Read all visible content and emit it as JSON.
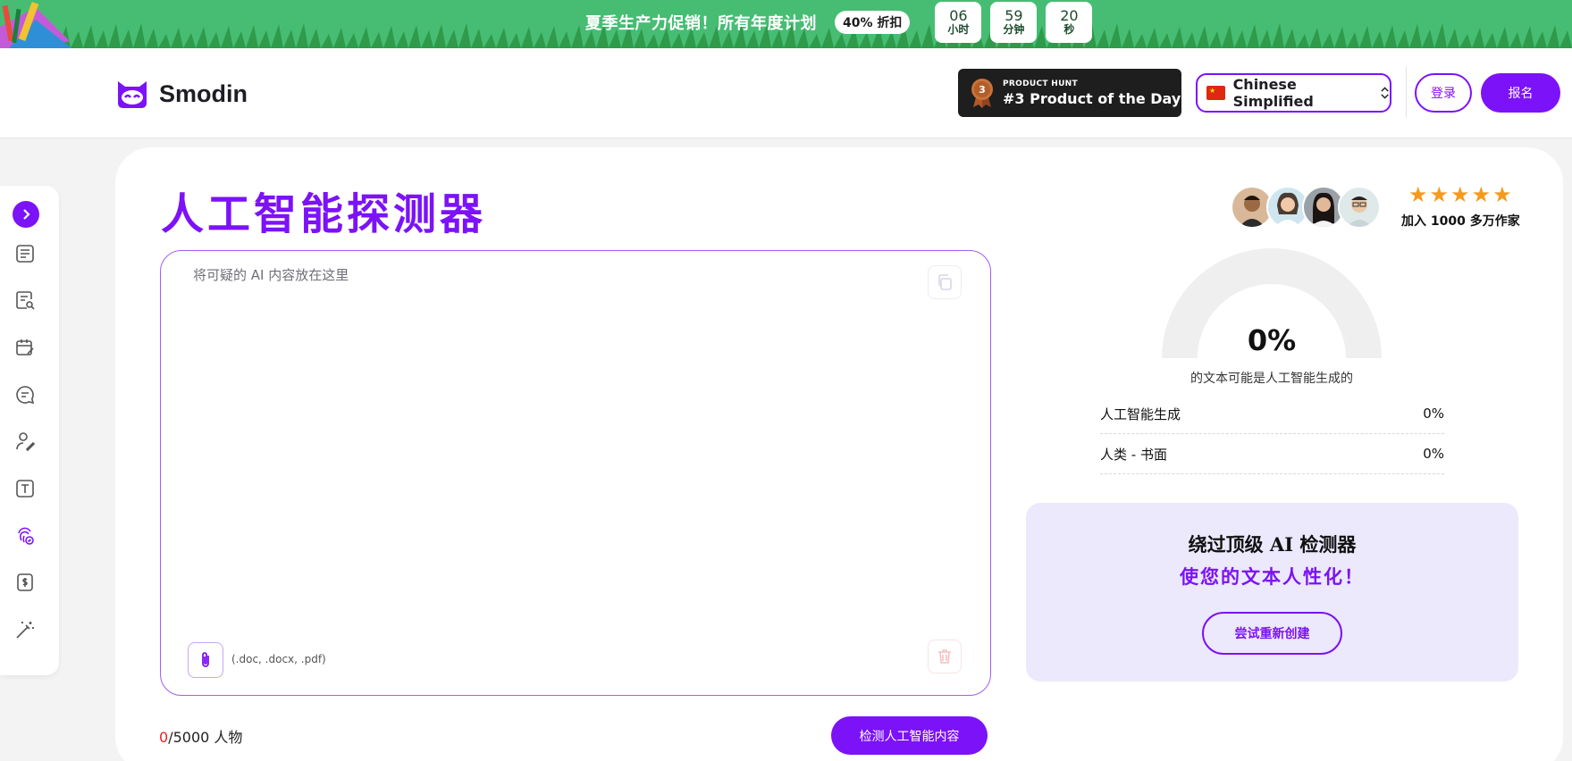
{
  "banner": {
    "text": "夏季生产力促销！所有年度计划",
    "discount": "40% 折扣",
    "timer": [
      {
        "value": "06",
        "unit": "小时"
      },
      {
        "value": "59",
        "unit": "分钟"
      },
      {
        "value": "20",
        "unit": "秒"
      }
    ]
  },
  "header": {
    "logo": "Smodin",
    "product_hunt": {
      "rank_digit": "3",
      "small": "PRODUCT HUNT",
      "big": "#3 Product of the Day"
    },
    "language": "Chinese Simplified",
    "login": "登录",
    "signup": "报名"
  },
  "sidebar": {
    "icons": [
      "document-lines-icon",
      "document-search-icon",
      "calendar-edit-icon",
      "chat-lines-icon",
      "user-pen-icon",
      "text-box-icon",
      "fingerprint-check-icon",
      "dollar-document-icon",
      "magic-wand-icon"
    ]
  },
  "main": {
    "title": "人工智能探测器",
    "placeholder": "将可疑的 AI 内容放在这里",
    "formats": "(.doc, .docx, .pdf)",
    "count_current": "0",
    "count_rest": "/5000 人物",
    "detect_button": "检测人工智能内容"
  },
  "results": {
    "stars": "★★★★★",
    "writers": "加入 1000 多万作家",
    "percent": "0%",
    "caption": "的文本可能是人工智能生成的",
    "rows": [
      {
        "label": "人工智能生成",
        "value": "0%"
      },
      {
        "label": "人类 - 书面",
        "value": "0%"
      }
    ]
  },
  "bypass": {
    "line1": "绕过顶级 AI 检测器",
    "line2": "使您的文本人性化！",
    "button": "尝试重新创建"
  },
  "colors": {
    "accent": "#7c12f8",
    "banner": "#46bd73",
    "star": "#f59a1c"
  }
}
